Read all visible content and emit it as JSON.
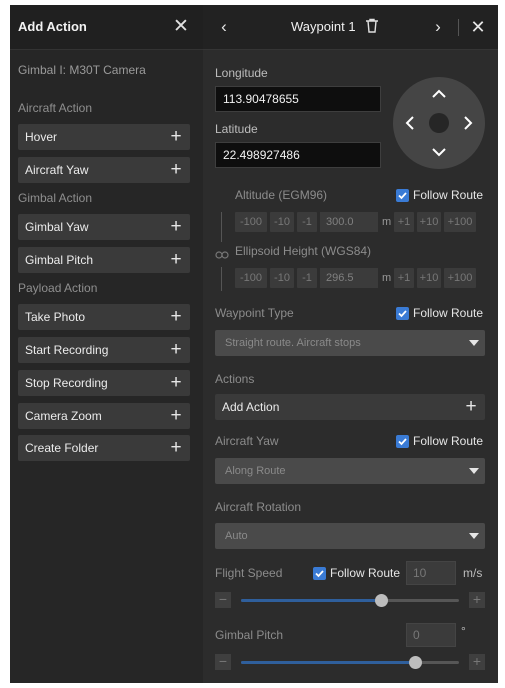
{
  "left_panel": {
    "title": "Add Action",
    "gimbal": "Gimbal I: M30T Camera",
    "sections": [
      {
        "label": "Aircraft Action",
        "items": [
          "Hover",
          "Aircraft Yaw"
        ]
      },
      {
        "label": "Gimbal Action",
        "items": [
          "Gimbal Yaw",
          "Gimbal Pitch"
        ]
      },
      {
        "label": "Payload Action",
        "items": [
          "Take Photo",
          "Start Recording",
          "Stop Recording",
          "Camera Zoom",
          "Create Folder"
        ]
      }
    ],
    "plus_glyph": "+",
    "close_glyph": "✕"
  },
  "right_panel": {
    "header": {
      "title": "Waypoint 1",
      "prev_glyph": "‹",
      "next_glyph": "›",
      "close_glyph": "✕"
    },
    "longitude": {
      "label": "Longitude",
      "value": "113.90478655"
    },
    "latitude": {
      "label": "Latitude",
      "value": "22.498927486"
    },
    "altitude": {
      "label": "Altitude (EGM96)",
      "follow_route": "Follow Route",
      "minus_steps": [
        "-100",
        "-10",
        "-1"
      ],
      "value": "300.0",
      "unit": "m",
      "plus_steps": [
        "+1",
        "+10",
        "+100"
      ]
    },
    "ellipsoid": {
      "label": "Ellipsoid Height (WGS84)",
      "minus_steps": [
        "-100",
        "-10",
        "-1"
      ],
      "value": "296.5",
      "unit": "m",
      "plus_steps": [
        "+1",
        "+10",
        "+100"
      ]
    },
    "waypoint_type": {
      "label": "Waypoint Type",
      "follow_route": "Follow Route",
      "value": "Straight route. Aircraft stops"
    },
    "actions": {
      "label": "Actions",
      "add_label": "Add Action",
      "plus_glyph": "+"
    },
    "aircraft_yaw": {
      "label": "Aircraft Yaw",
      "follow_route": "Follow Route",
      "value": "Along Route"
    },
    "aircraft_rotation": {
      "label": "Aircraft Rotation",
      "value": "Auto"
    },
    "flight_speed": {
      "label": "Flight Speed",
      "follow_route": "Follow Route",
      "value": "10",
      "unit": "m/s",
      "slider_fraction": 0.64,
      "minus_glyph": "−",
      "plus_glyph": "+"
    },
    "gimbal_pitch": {
      "label": "Gimbal Pitch",
      "value": "0",
      "unit": "°",
      "slider_fraction": 0.8,
      "minus_glyph": "−",
      "plus_glyph": "+"
    }
  },
  "colors": {
    "accent": "#3a7bd5",
    "slider_fill": "#2f5f9c"
  }
}
